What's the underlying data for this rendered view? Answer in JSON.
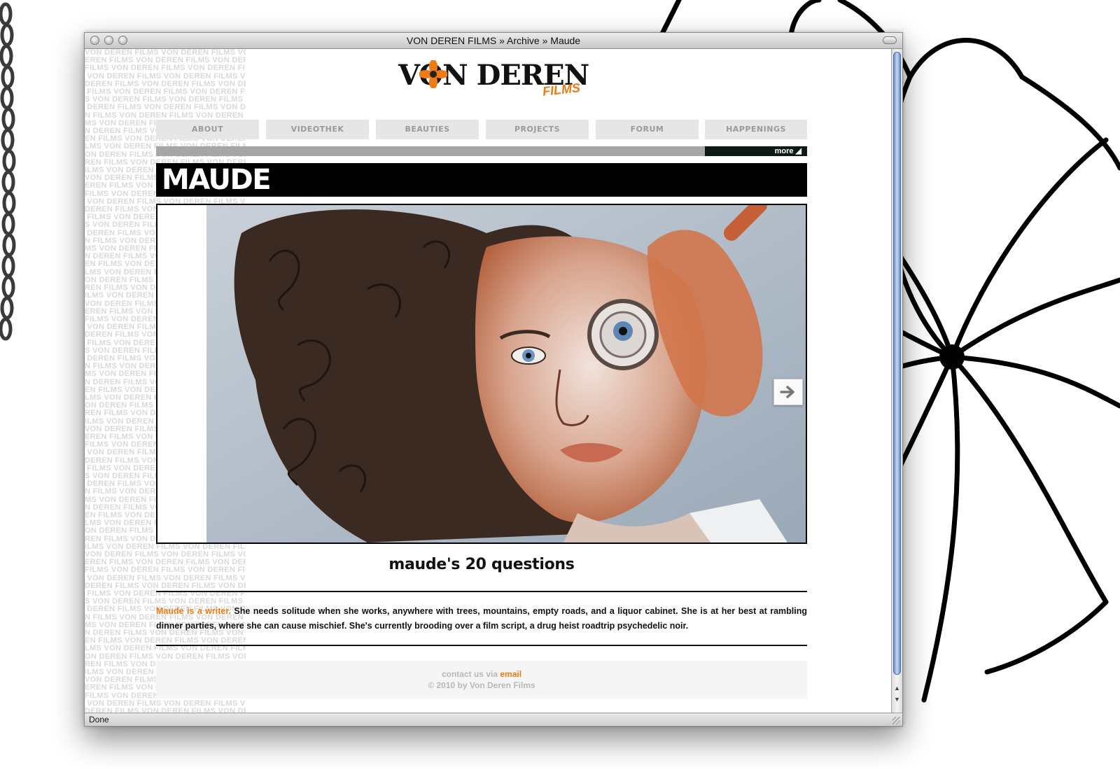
{
  "window": {
    "title": "VON DEREN FILMS » Archive » Maude",
    "status": "Done"
  },
  "watermark_text": "VON DEREN FILMS",
  "logo": {
    "main": "VON DEREN",
    "sub": "FILMS"
  },
  "nav": {
    "items": [
      "ABOUT",
      "VIDEOTHEK",
      "BEAUTIES",
      "PROJECTS",
      "FORUM",
      "HAPPENINGS"
    ],
    "more_label": "more ◢"
  },
  "page": {
    "title": "MAUDE",
    "subtitle": "maude's 20 questions",
    "description_lead": "Maude is a writer.",
    "description_body": " She needs solitude when she works, anywhere with trees, mountains, empty roads, and a liquor cabinet. She is at her best at rambling dinner parties, where she can cause mischief. She's currently brooding over a film script, a drug heist roadtrip psychedelic noir."
  },
  "footer": {
    "contact_prefix": "contact us via ",
    "contact_link": "email",
    "copyright": "© 2010 by Von Deren Films"
  },
  "colors": {
    "accent": "#f07a13",
    "nav_bg": "#e6e6e6",
    "title_bg": "#000000"
  },
  "icons": {
    "next": "arrow-right-icon"
  }
}
